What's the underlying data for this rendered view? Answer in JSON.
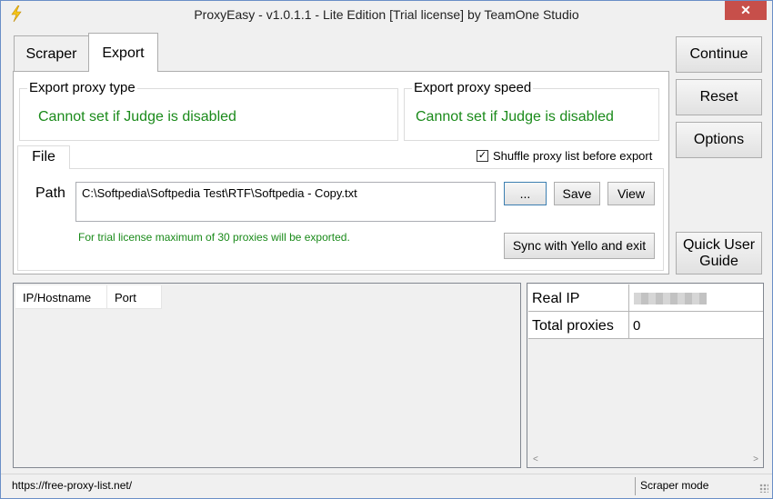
{
  "window": {
    "title": "ProxyEasy - v1.0.1.1 - Lite Edition [Trial license] by TeamOne Studio",
    "close_label": "✕"
  },
  "tabs": [
    {
      "label": "Scraper"
    },
    {
      "label": "Export"
    }
  ],
  "export": {
    "type_group": {
      "title": "Export proxy type",
      "message": "Cannot set if Judge is disabled"
    },
    "speed_group": {
      "title": "Export proxy speed",
      "message": "Cannot set if Judge is disabled"
    },
    "file_tab": "File",
    "shuffle": {
      "label": "Shuffle proxy list before export",
      "checked": true,
      "mark": "✓"
    },
    "path_label": "Path",
    "path_value": "C:\\Softpedia\\Softpedia Test\\RTF\\Softpedia - Copy.txt",
    "browse_label": "...",
    "save_label": "Save",
    "view_label": "View",
    "trial_note": "For trial license maximum of 30 proxies will be exported.",
    "sync_label": "Sync with Yello and exit"
  },
  "side_buttons": {
    "continue": "Continue",
    "reset": "Reset",
    "options": "Options",
    "guide_line1": "Quick User",
    "guide_line2": "Guide"
  },
  "proxy_list": {
    "columns": [
      "IP/Hostname",
      "Port"
    ],
    "rows": []
  },
  "info": {
    "real_ip_label": "Real IP",
    "real_ip_value": "",
    "total_label": "Total proxies",
    "total_value": "0"
  },
  "statusbar": {
    "left": "https://free-proxy-list.net/",
    "right": "Scraper mode"
  },
  "colors": {
    "green_text": "#1a8a1a",
    "close_red": "#c74f4a"
  },
  "icons": {
    "app": "lightning-icon"
  }
}
